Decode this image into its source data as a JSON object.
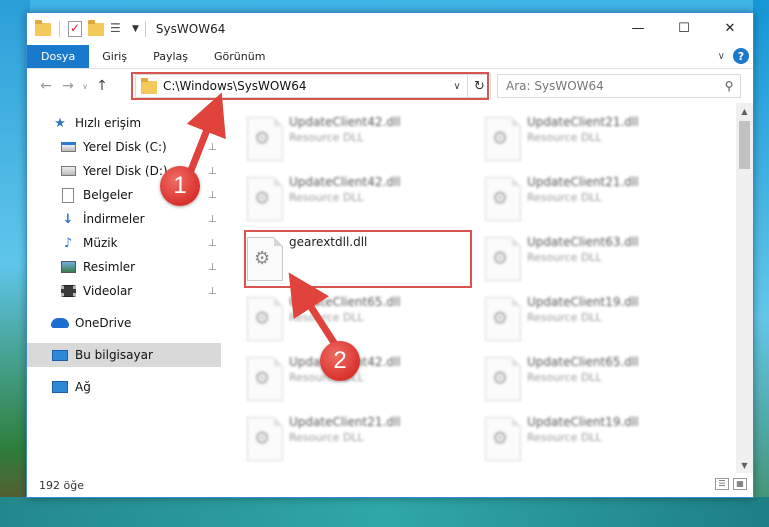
{
  "window": {
    "title": "SysWOW64",
    "minimize_glyph": "—",
    "maximize_glyph": "☐",
    "close_glyph": "✕"
  },
  "ribbon": {
    "tabs": [
      "Dosya",
      "Giriş",
      "Paylaş",
      "Görünüm"
    ],
    "expand_glyph": "∨",
    "help_glyph": "?"
  },
  "navigation": {
    "back_glyph": "←",
    "forward_glyph": "→",
    "recent_glyph": "∨",
    "up_glyph": "↑",
    "address": "C:\\Windows\\SysWOW64",
    "address_dropdown_glyph": "∨",
    "refresh_glyph": "↻",
    "search_placeholder": "Ara: SysWOW64",
    "search_glyph": "⚲"
  },
  "sidebar": {
    "quick_access": "Hızlı erişim",
    "items": [
      "Yerel Disk (C:)",
      "Yerel Disk (D:)",
      "Belgeler",
      "İndirmeler",
      "Müzik",
      "Resimler",
      "Videolar"
    ],
    "pin_glyph": "📌",
    "onedrive": "OneDrive",
    "this_pc": "Bu bilgisayar",
    "network": "Ağ"
  },
  "files": {
    "left_column": [
      {
        "name": "UpdateClient42.dll",
        "type": "Resource DLL"
      },
      {
        "name": "UpdateClient42.dll",
        "type": "Resource DLL"
      },
      {
        "name": "gearextdll.dll",
        "type": ""
      },
      {
        "name": "UpdateClient65.dll",
        "type": "Resource DLL"
      },
      {
        "name": "UpdateClient42.dll",
        "type": "Resource DLL"
      },
      {
        "name": "UpdateClient21.dll",
        "type": "Resource DLL"
      }
    ],
    "right_column": [
      {
        "name": "UpdateClient21.dll",
        "type": "Resource DLL"
      },
      {
        "name": "UpdateClient21.dll",
        "type": "Resource DLL"
      },
      {
        "name": "UpdateClient63.dll",
        "type": "Resource DLL"
      },
      {
        "name": "UpdateClient19.dll",
        "type": "Resource DLL"
      },
      {
        "name": "UpdateClient65.dll",
        "type": "Resource DLL"
      },
      {
        "name": "UpdateClient19.dll",
        "type": "Resource DLL"
      }
    ]
  },
  "status": {
    "count": "192 öğe"
  },
  "annotations": {
    "badge_1": "1",
    "badge_2": "2",
    "color": "#d9534f"
  }
}
